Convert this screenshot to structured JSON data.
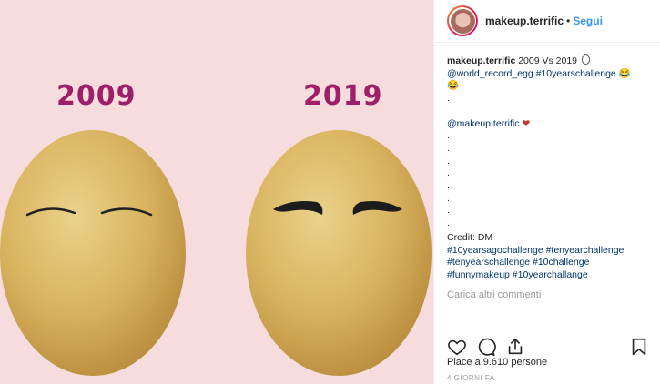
{
  "image": {
    "year_left": "2009",
    "year_right": "2019"
  },
  "header": {
    "username": "makeup.terrific",
    "separator": "•",
    "follow_label": "Segui"
  },
  "caption": {
    "username": "makeup.terrific",
    "text": "2009 Vs 2019",
    "line2": "@world_record_egg #10yearschallenge",
    "emoji_laugh": "😂",
    "mention": "@makeup.terrific",
    "heart": "❤",
    "dot": ".",
    "credit": "Credit: DM",
    "hashtags_1": "#10yearsagochallenge #tenyearchallenge",
    "hashtags_2": "#tenyearschallenge #10challenge",
    "hashtags_3": "#funnymakeup #10yearchallange"
  },
  "load_more": "Carica altri commenti",
  "likes": "Piace a 9.610 persone",
  "timestamp": "4 GIORNI FA"
}
